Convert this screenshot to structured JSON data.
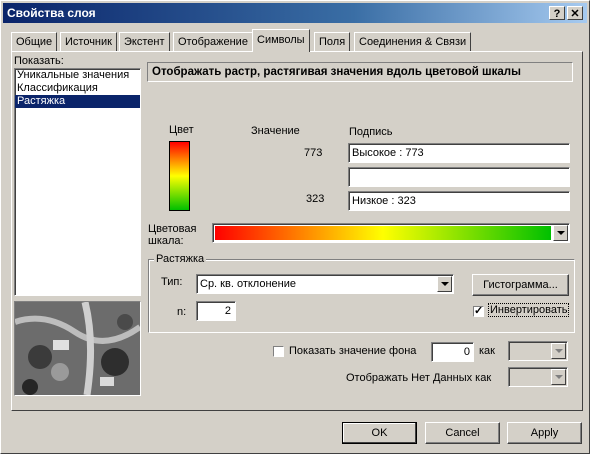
{
  "window": {
    "title": "Свойства слоя",
    "help_label": "?",
    "close_label": "✕"
  },
  "tabs": [
    {
      "label": "Общие"
    },
    {
      "label": "Источник"
    },
    {
      "label": "Экстент"
    },
    {
      "label": "Отображение"
    },
    {
      "label": "Символы"
    },
    {
      "label": "Поля"
    },
    {
      "label": "Соединения & Связи"
    }
  ],
  "show": {
    "label": "Показать:",
    "items": [
      {
        "label": "Уникальные значения"
      },
      {
        "label": "Классификация"
      },
      {
        "label": "Растяжка"
      }
    ]
  },
  "heading": "Отображать растр, растягивая значения вдоль цветовой шкалы",
  "legend": {
    "color_header": "Цвет",
    "value_header": "Значение",
    "label_header": "Подпись",
    "high_value": "773",
    "high_label": "Высокое : 773",
    "mid_label": "",
    "low_value": "323",
    "low_label": "Низкое : 323"
  },
  "color_scale_label": "Цветовая шкала:",
  "colors": {
    "ramp_start": "#ff0000",
    "ramp_mid": "#ffff00",
    "ramp_end": "#00c000",
    "selection": "#0a246a"
  },
  "stretch": {
    "group_label": "Растяжка",
    "type_label": "Тип:",
    "type_value": "Ср. кв. отклонение",
    "histogram_button": "Гистограмма...",
    "n_label": "n:",
    "n_value": "2",
    "invert_label": "Инвертировать",
    "invert_checked": true
  },
  "background": {
    "label": "Показать значение фона",
    "value": "0",
    "as_label": "как",
    "checked": false
  },
  "nodata_label": "Отображать Нет Данных как",
  "buttons": {
    "ok": "OK",
    "cancel": "Cancel",
    "apply": "Apply"
  }
}
